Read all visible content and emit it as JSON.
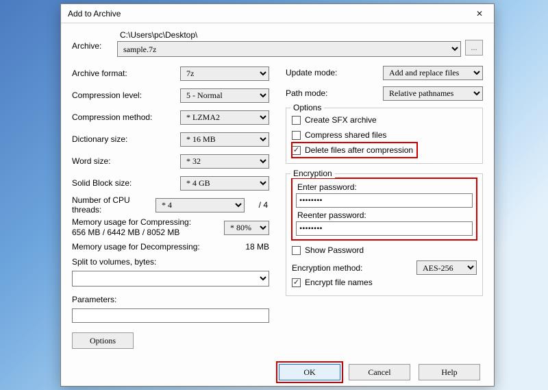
{
  "title": "Add to Archive",
  "archive": {
    "label": "Archive:",
    "path": "C:\\Users\\pc\\Desktop\\",
    "filename": "sample.7z"
  },
  "left": {
    "format": {
      "label": "Archive format:",
      "value": "7z"
    },
    "level": {
      "label": "Compression level:",
      "value": "5 - Normal"
    },
    "method": {
      "label": "Compression method:",
      "value": "* LZMA2"
    },
    "dict": {
      "label": "Dictionary size:",
      "value": "* 16 MB"
    },
    "word": {
      "label": "Word size:",
      "value": "* 32"
    },
    "block": {
      "label": "Solid Block size:",
      "value": "* 4 GB"
    },
    "threads": {
      "label": "Number of CPU threads:",
      "value": "* 4",
      "total": "/ 4"
    },
    "mem_c": {
      "label": "Memory usage for Compressing:",
      "detail": "656 MB / 6442 MB / 8052 MB",
      "pct": "* 80%"
    },
    "mem_d": {
      "label": "Memory usage for Decompressing:",
      "value": "18 MB"
    },
    "split": {
      "label": "Split to volumes, bytes:",
      "value": ""
    },
    "params": {
      "label": "Parameters:",
      "value": ""
    },
    "options_btn": "Options"
  },
  "right": {
    "update": {
      "label": "Update mode:",
      "value": "Add and replace files"
    },
    "path": {
      "label": "Path mode:",
      "value": "Relative pathnames"
    },
    "options": {
      "title": "Options",
      "sfx": {
        "label": "Create SFX archive",
        "checked": false
      },
      "shared": {
        "label": "Compress shared files",
        "checked": false
      },
      "delete": {
        "label": "Delete files after compression",
        "checked": true
      }
    },
    "encryption": {
      "title": "Encryption",
      "pass_lbl": "Enter password:",
      "repass_lbl": "Reenter password:",
      "pass_value": "********",
      "repass_value": "********",
      "show": {
        "label": "Show Password",
        "checked": false
      },
      "method": {
        "label": "Encryption method:",
        "value": "AES-256"
      },
      "names": {
        "label": "Encrypt file names",
        "checked": true
      }
    }
  },
  "footer": {
    "ok": "OK",
    "cancel": "Cancel",
    "help": "Help"
  },
  "browse_btn": "..."
}
